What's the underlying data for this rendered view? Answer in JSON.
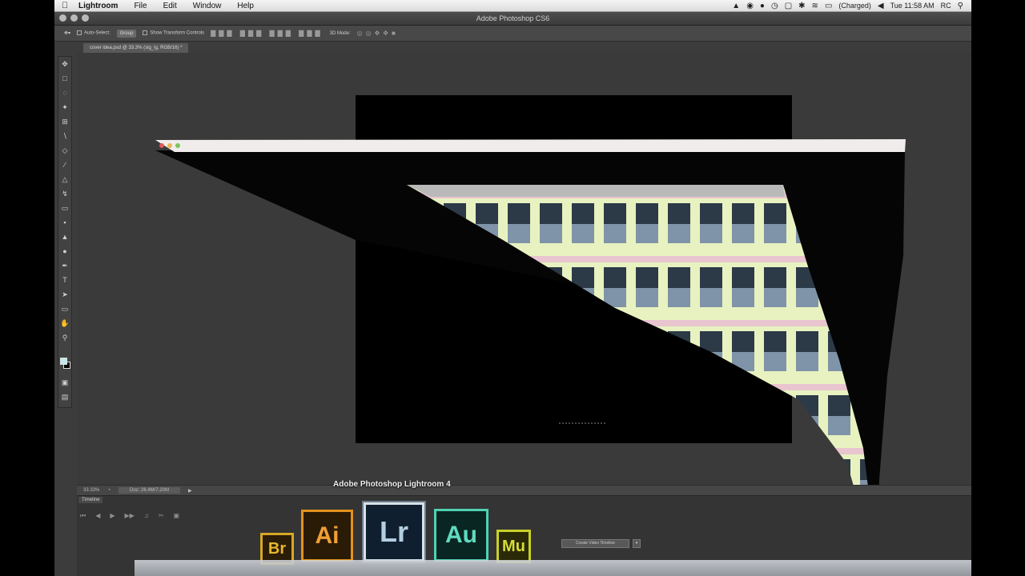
{
  "menubar": {
    "apple": "",
    "app_name": "Lightroom",
    "menus": [
      "File",
      "Edit",
      "Window",
      "Help"
    ],
    "status": {
      "charged": "(Charged)",
      "time": "Tue 11:58 AM",
      "user": "RC"
    }
  },
  "photoshop": {
    "window_title": "Adobe Photoshop CS6",
    "options": {
      "auto_select": "Auto-Select:",
      "group": "Group",
      "transform_controls": "Show Transform Controls",
      "mode_3d": "3D Mode:"
    },
    "document_tab": "cover idea.psd @ 33.3% (slg_lg, RGB/16) *",
    "status_bar": {
      "zoom": "33.33%",
      "doc_info": "Doc: 26.4M/7.20M"
    },
    "timeline": {
      "tab": "Timeline",
      "create_button": "Create Video Timeline"
    }
  },
  "app_switcher": {
    "title": "Adobe Photoshop Lightroom 4",
    "apps": [
      {
        "label": "Br"
      },
      {
        "label": "Ai"
      },
      {
        "label": "Lr"
      },
      {
        "label": "Au"
      },
      {
        "label": "Mu"
      }
    ]
  },
  "colors": {
    "bridge": "#d7a826",
    "illustrator": "#e4921b",
    "lightroom": "#b4cde0",
    "audition": "#4fd1b3",
    "muse": "#c8d129",
    "foreground_swatch": "#bfe9ee",
    "background_swatch": "#000000"
  }
}
